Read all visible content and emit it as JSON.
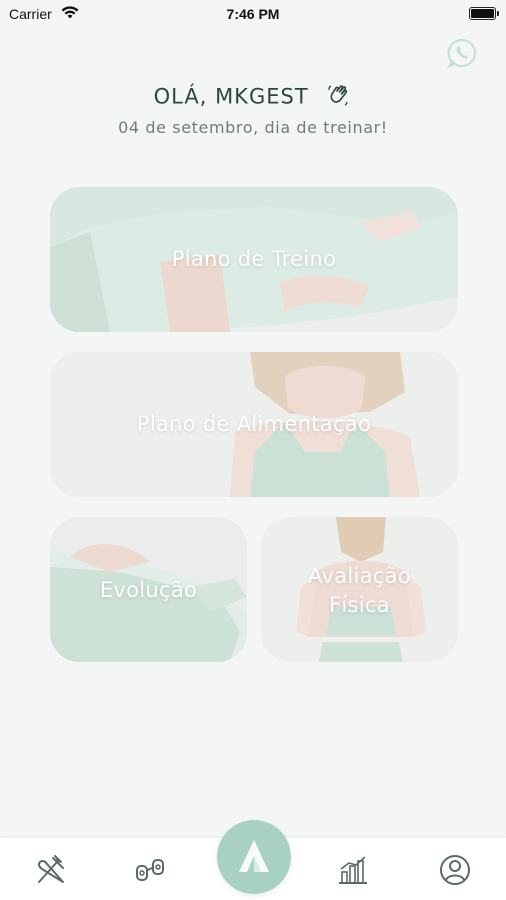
{
  "status_bar": {
    "carrier": "Carrier",
    "time": "7:46 PM"
  },
  "header": {
    "greeting": "OLÁ, MKGEST",
    "subtitle": "04 de setembro, dia de treinar!"
  },
  "cards": {
    "treino": "Plano de Treino",
    "alimentacao": "Plano de Alimentação",
    "evolucao": "Evolução",
    "avaliacao_line1": "Avaliação",
    "avaliacao_line2": "Física"
  },
  "icons": {
    "whatsapp": "whatsapp-icon",
    "wave": "waving-hand-icon",
    "tab_nutrition": "fork-knife-icon",
    "tab_workout": "dumbbell-icon",
    "tab_home": "logo-a-icon",
    "tab_progress": "bar-chart-icon",
    "tab_profile": "user-icon"
  },
  "colors": {
    "accent": "#a9d1c3",
    "text_dark": "#2d4642",
    "text_muted": "#6f7d7a",
    "background": "#f3f6f5"
  }
}
